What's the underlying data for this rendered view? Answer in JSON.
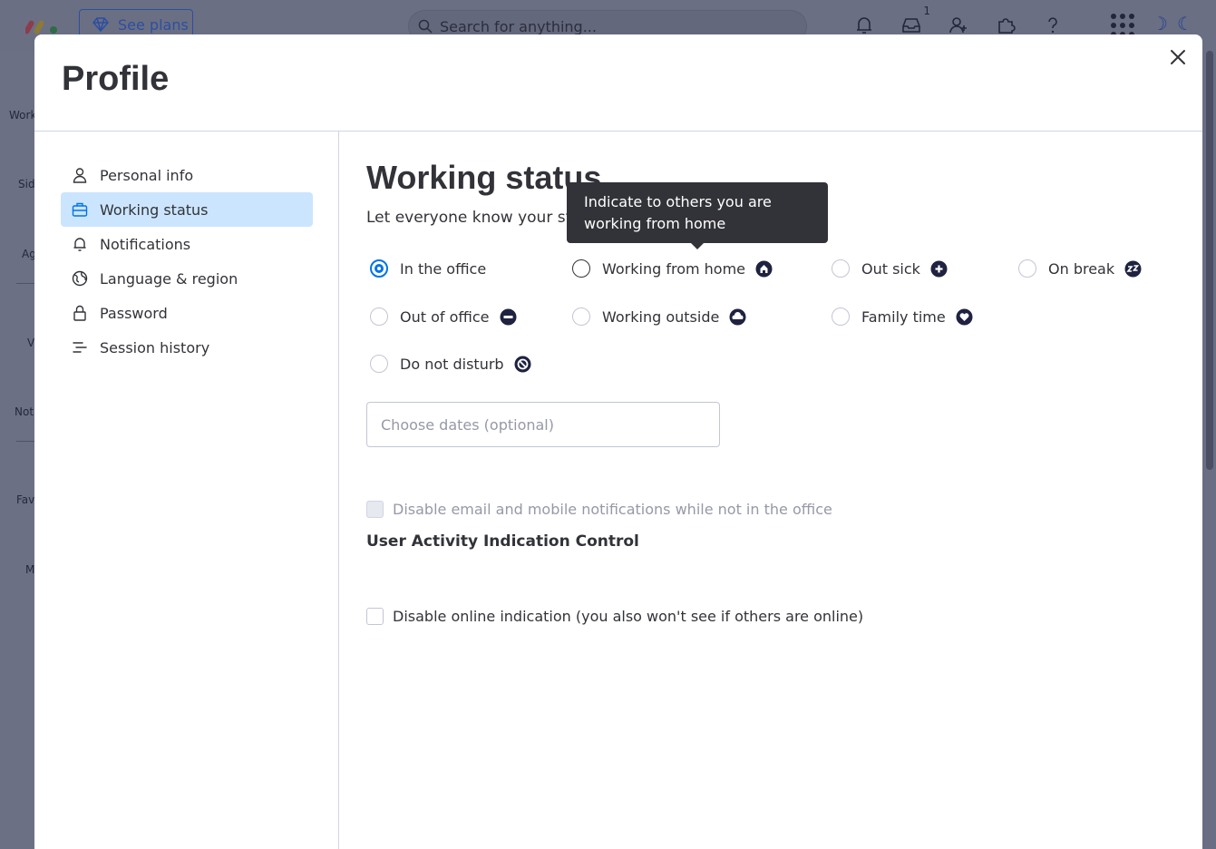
{
  "topbar": {
    "see_plans_label": "See plans",
    "search_placeholder": "Search for anything...",
    "inbox_badge": "1",
    "icons": [
      "bell-icon",
      "inbox-icon",
      "invite-user-icon",
      "puzzle-icon",
      "help-icon",
      "apps-grid-icon"
    ]
  },
  "left_rail": {
    "items": [
      "Work",
      "Sid",
      "Ag",
      "V",
      "Not",
      "Fav",
      "M"
    ]
  },
  "modal": {
    "title": "Profile",
    "close_icon": "close-icon"
  },
  "sidebar": {
    "items": [
      {
        "label": "Personal info",
        "icon": "person-icon",
        "active": false
      },
      {
        "label": "Working status",
        "icon": "briefcase-icon",
        "active": true
      },
      {
        "label": "Notifications",
        "icon": "bell-icon",
        "active": false
      },
      {
        "label": "Language & region",
        "icon": "globe-icon",
        "active": false
      },
      {
        "label": "Password",
        "icon": "lock-icon",
        "active": false
      },
      {
        "label": "Session history",
        "icon": "list-icon",
        "active": false
      }
    ]
  },
  "working_status": {
    "title": "Working status",
    "subtitle": "Let everyone know your st",
    "options": [
      {
        "label": "In the office",
        "checked": true,
        "icon": ""
      },
      {
        "label": "Working from home",
        "checked": false,
        "icon": "home-icon"
      },
      {
        "label": "Out sick",
        "checked": false,
        "icon": "plus-icon"
      },
      {
        "label": "On break",
        "checked": false,
        "icon": "zzz-icon"
      },
      {
        "label": "Out of office",
        "checked": false,
        "icon": "minus-icon"
      },
      {
        "label": "Working outside",
        "checked": false,
        "icon": "cloud-icon"
      },
      {
        "label": "Family time",
        "checked": false,
        "icon": "heart-icon"
      },
      {
        "label": "Do not disturb",
        "checked": false,
        "icon": "do-not-disturb-icon"
      }
    ],
    "dates_placeholder": "Choose dates (optional)",
    "disable_notifications_label": "Disable email and mobile notifications while not in the office",
    "activity_heading": "User Activity Indication Control",
    "disable_online_label": "Disable online indication (you also won't see if others are online)"
  },
  "tooltip": {
    "text": "Indicate to others you are working from home"
  },
  "colors": {
    "accent": "#0073ea",
    "active_nav_bg": "#cce5ff",
    "tooltip_bg": "#323338",
    "overlay": "#6e7288"
  }
}
